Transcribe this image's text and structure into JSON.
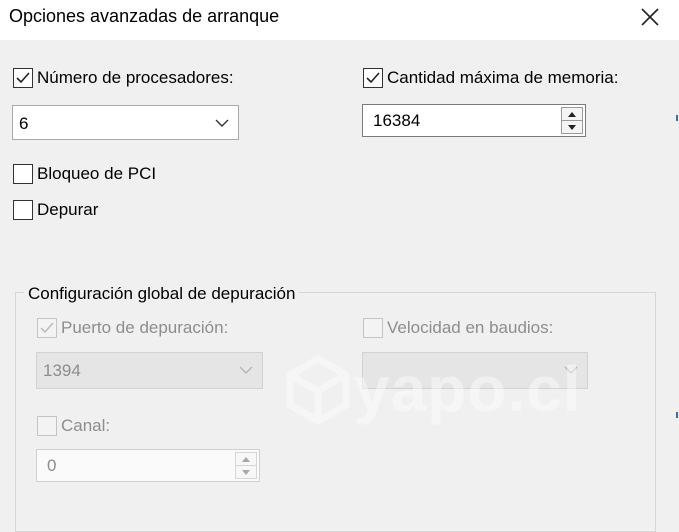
{
  "window": {
    "title": "Opciones avanzadas de arranque"
  },
  "processors": {
    "label": "Número de procesadores:",
    "checked": true,
    "value": "6"
  },
  "memory": {
    "label": "Cantidad máxima de memoria:",
    "checked": true,
    "value": "16384"
  },
  "pci_lock": {
    "label": "Bloqueo de PCI",
    "checked": false
  },
  "debug": {
    "label": "Depurar",
    "checked": false
  },
  "global_debug": {
    "title": "Configuración global de depuración",
    "debug_port": {
      "label": "Puerto de depuración:",
      "checked": true,
      "value": "1394",
      "enabled": false
    },
    "baud_rate": {
      "label": "Velocidad en baudios:",
      "checked": false,
      "value": "",
      "enabled": false
    },
    "channel": {
      "label": "Canal:",
      "checked": false,
      "value": "0",
      "enabled": false
    }
  },
  "watermark": {
    "text": "yapo.cl"
  },
  "colors": {
    "accent": "#3a6ea5",
    "disabled_text": "#8d8d8d",
    "background": "#f0f0f0"
  }
}
